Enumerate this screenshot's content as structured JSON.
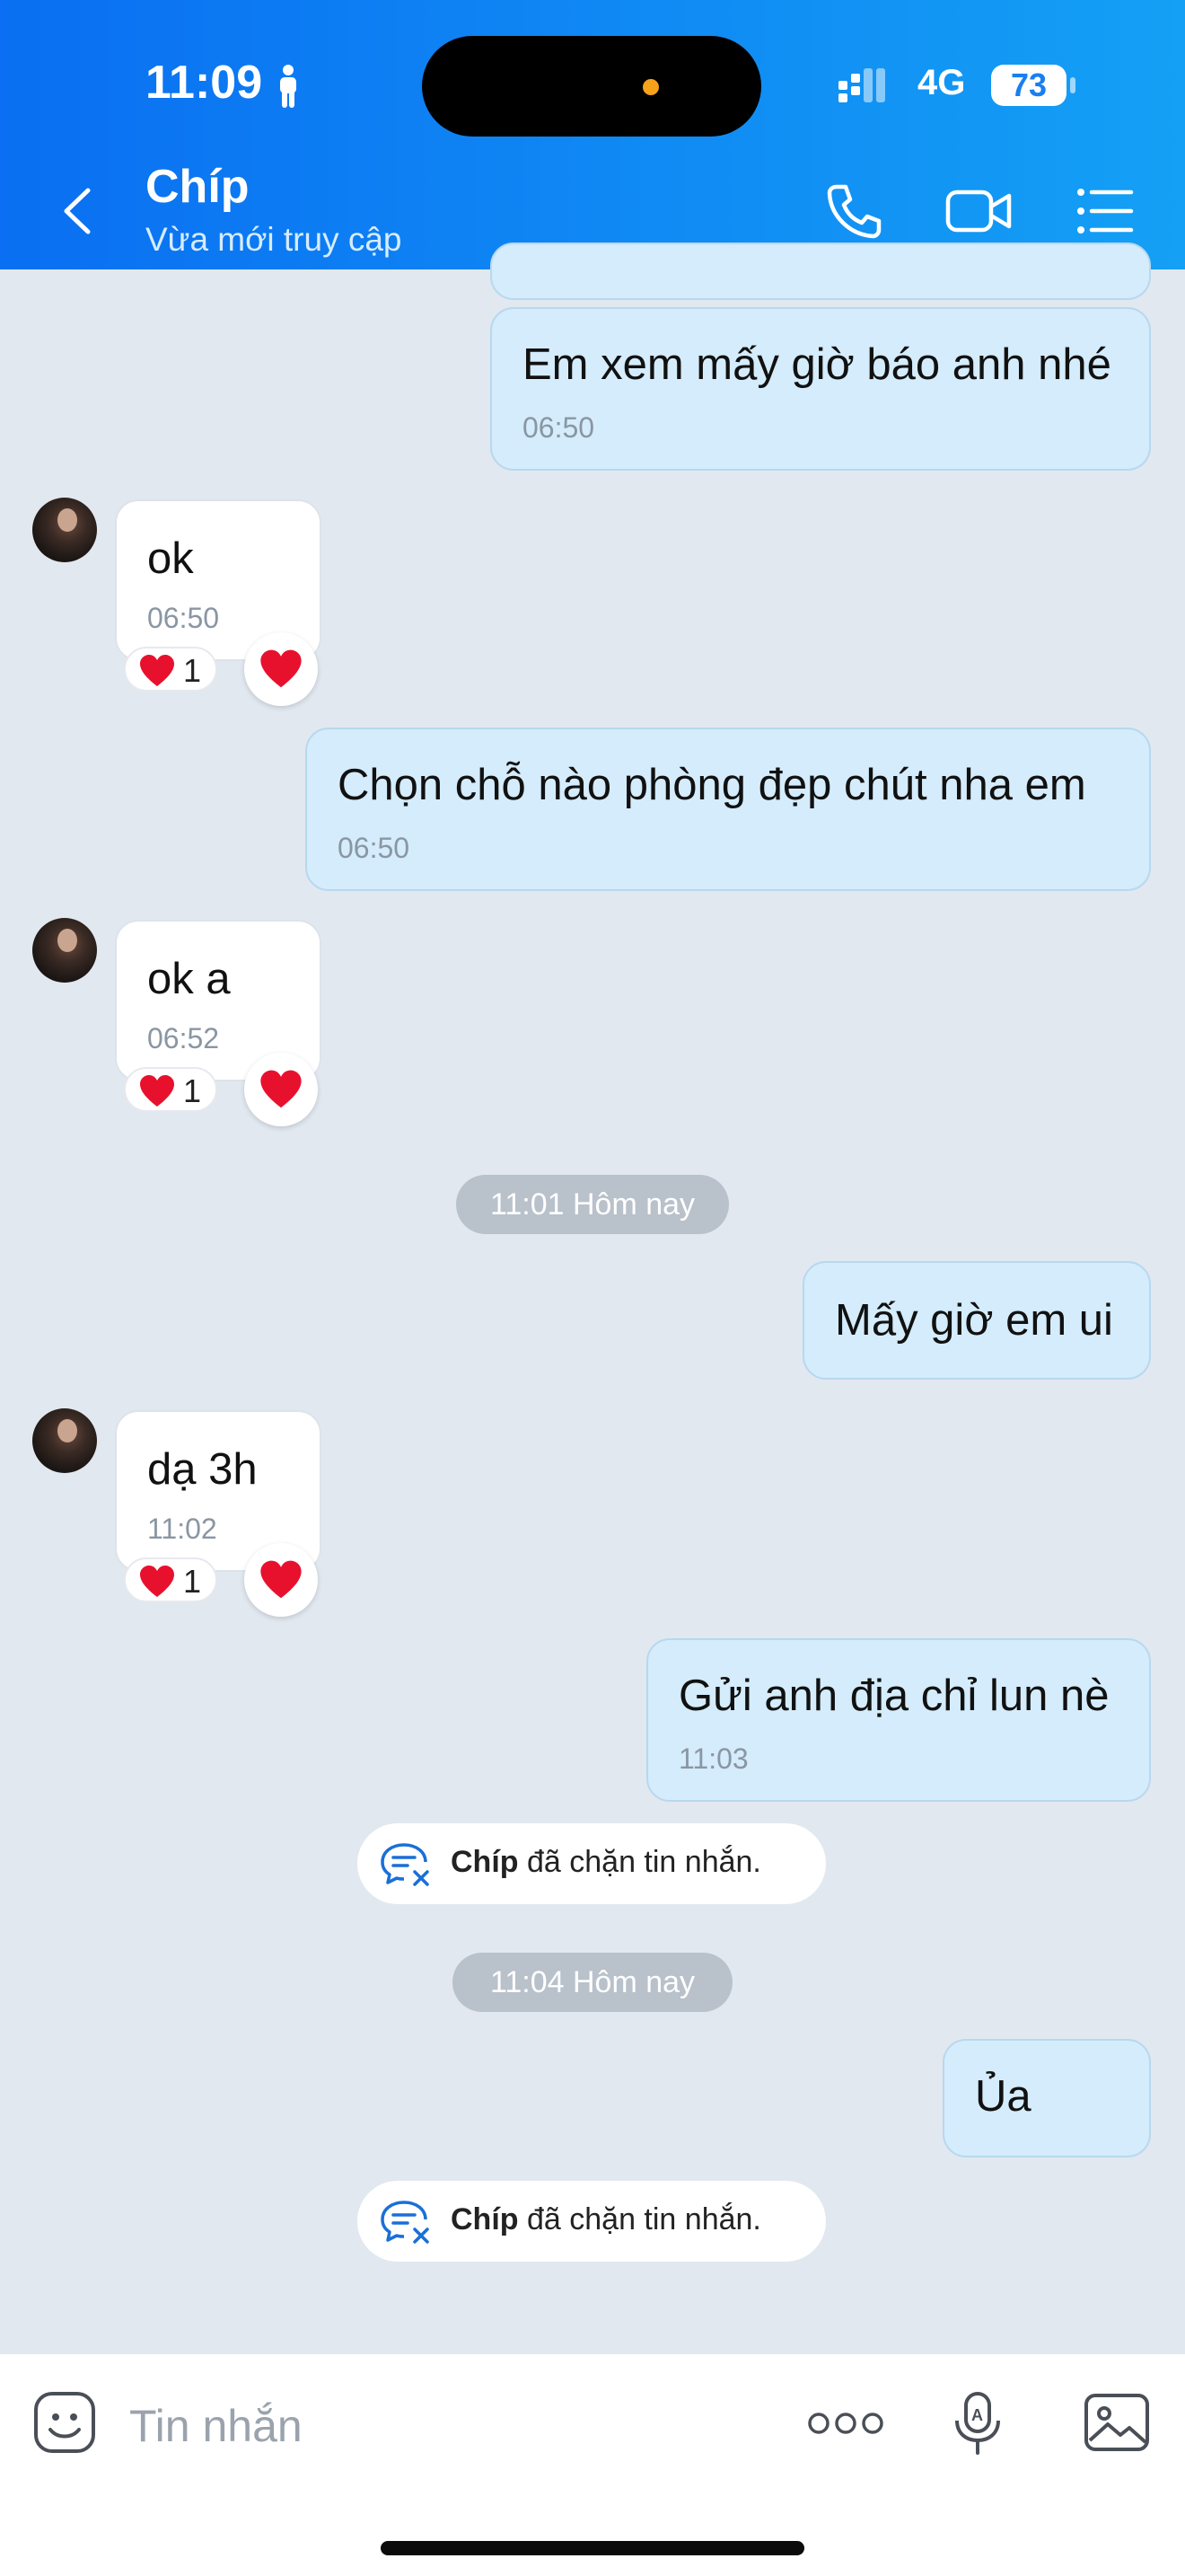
{
  "status_bar": {
    "time": "11:09",
    "network": "4G",
    "battery": "73"
  },
  "header": {
    "title": "Chíp",
    "subtitle": "Vừa mới truy cập"
  },
  "messages": [
    {
      "text": "Em xem mấy giờ báo anh nhé",
      "time": "06:50"
    },
    {
      "text": "ok",
      "time": "06:50",
      "reaction_count": "1"
    },
    {
      "text": "Chọn chỗ nào phòng đẹp chút nha em",
      "time": "06:50"
    },
    {
      "text": "ok a",
      "time": "06:52",
      "reaction_count": "1"
    },
    {
      "text": "Mấy giờ em ui"
    },
    {
      "text": "dạ 3h",
      "time": "11:02",
      "reaction_count": "1"
    },
    {
      "text": "Gửi anh địa chỉ lun nè",
      "time": "11:03"
    },
    {
      "text": "Ủa"
    }
  ],
  "time_separators": [
    "11:01 Hôm nay",
    "11:04 Hôm nay"
  ],
  "notices": [
    {
      "name": "Chíp",
      "text": " đã chặn tin nhắn."
    },
    {
      "name": "Chíp",
      "text": " đã chặn tin nhắn."
    }
  ],
  "composer": {
    "placeholder": "Tin nhắn"
  },
  "colors": {
    "header_start": "#0a6ff2",
    "header_end": "#14a0f5",
    "outgoing_bubble": "#d4ecfb",
    "chat_bg": "#e2e8f0",
    "reaction": "#e8112d"
  }
}
